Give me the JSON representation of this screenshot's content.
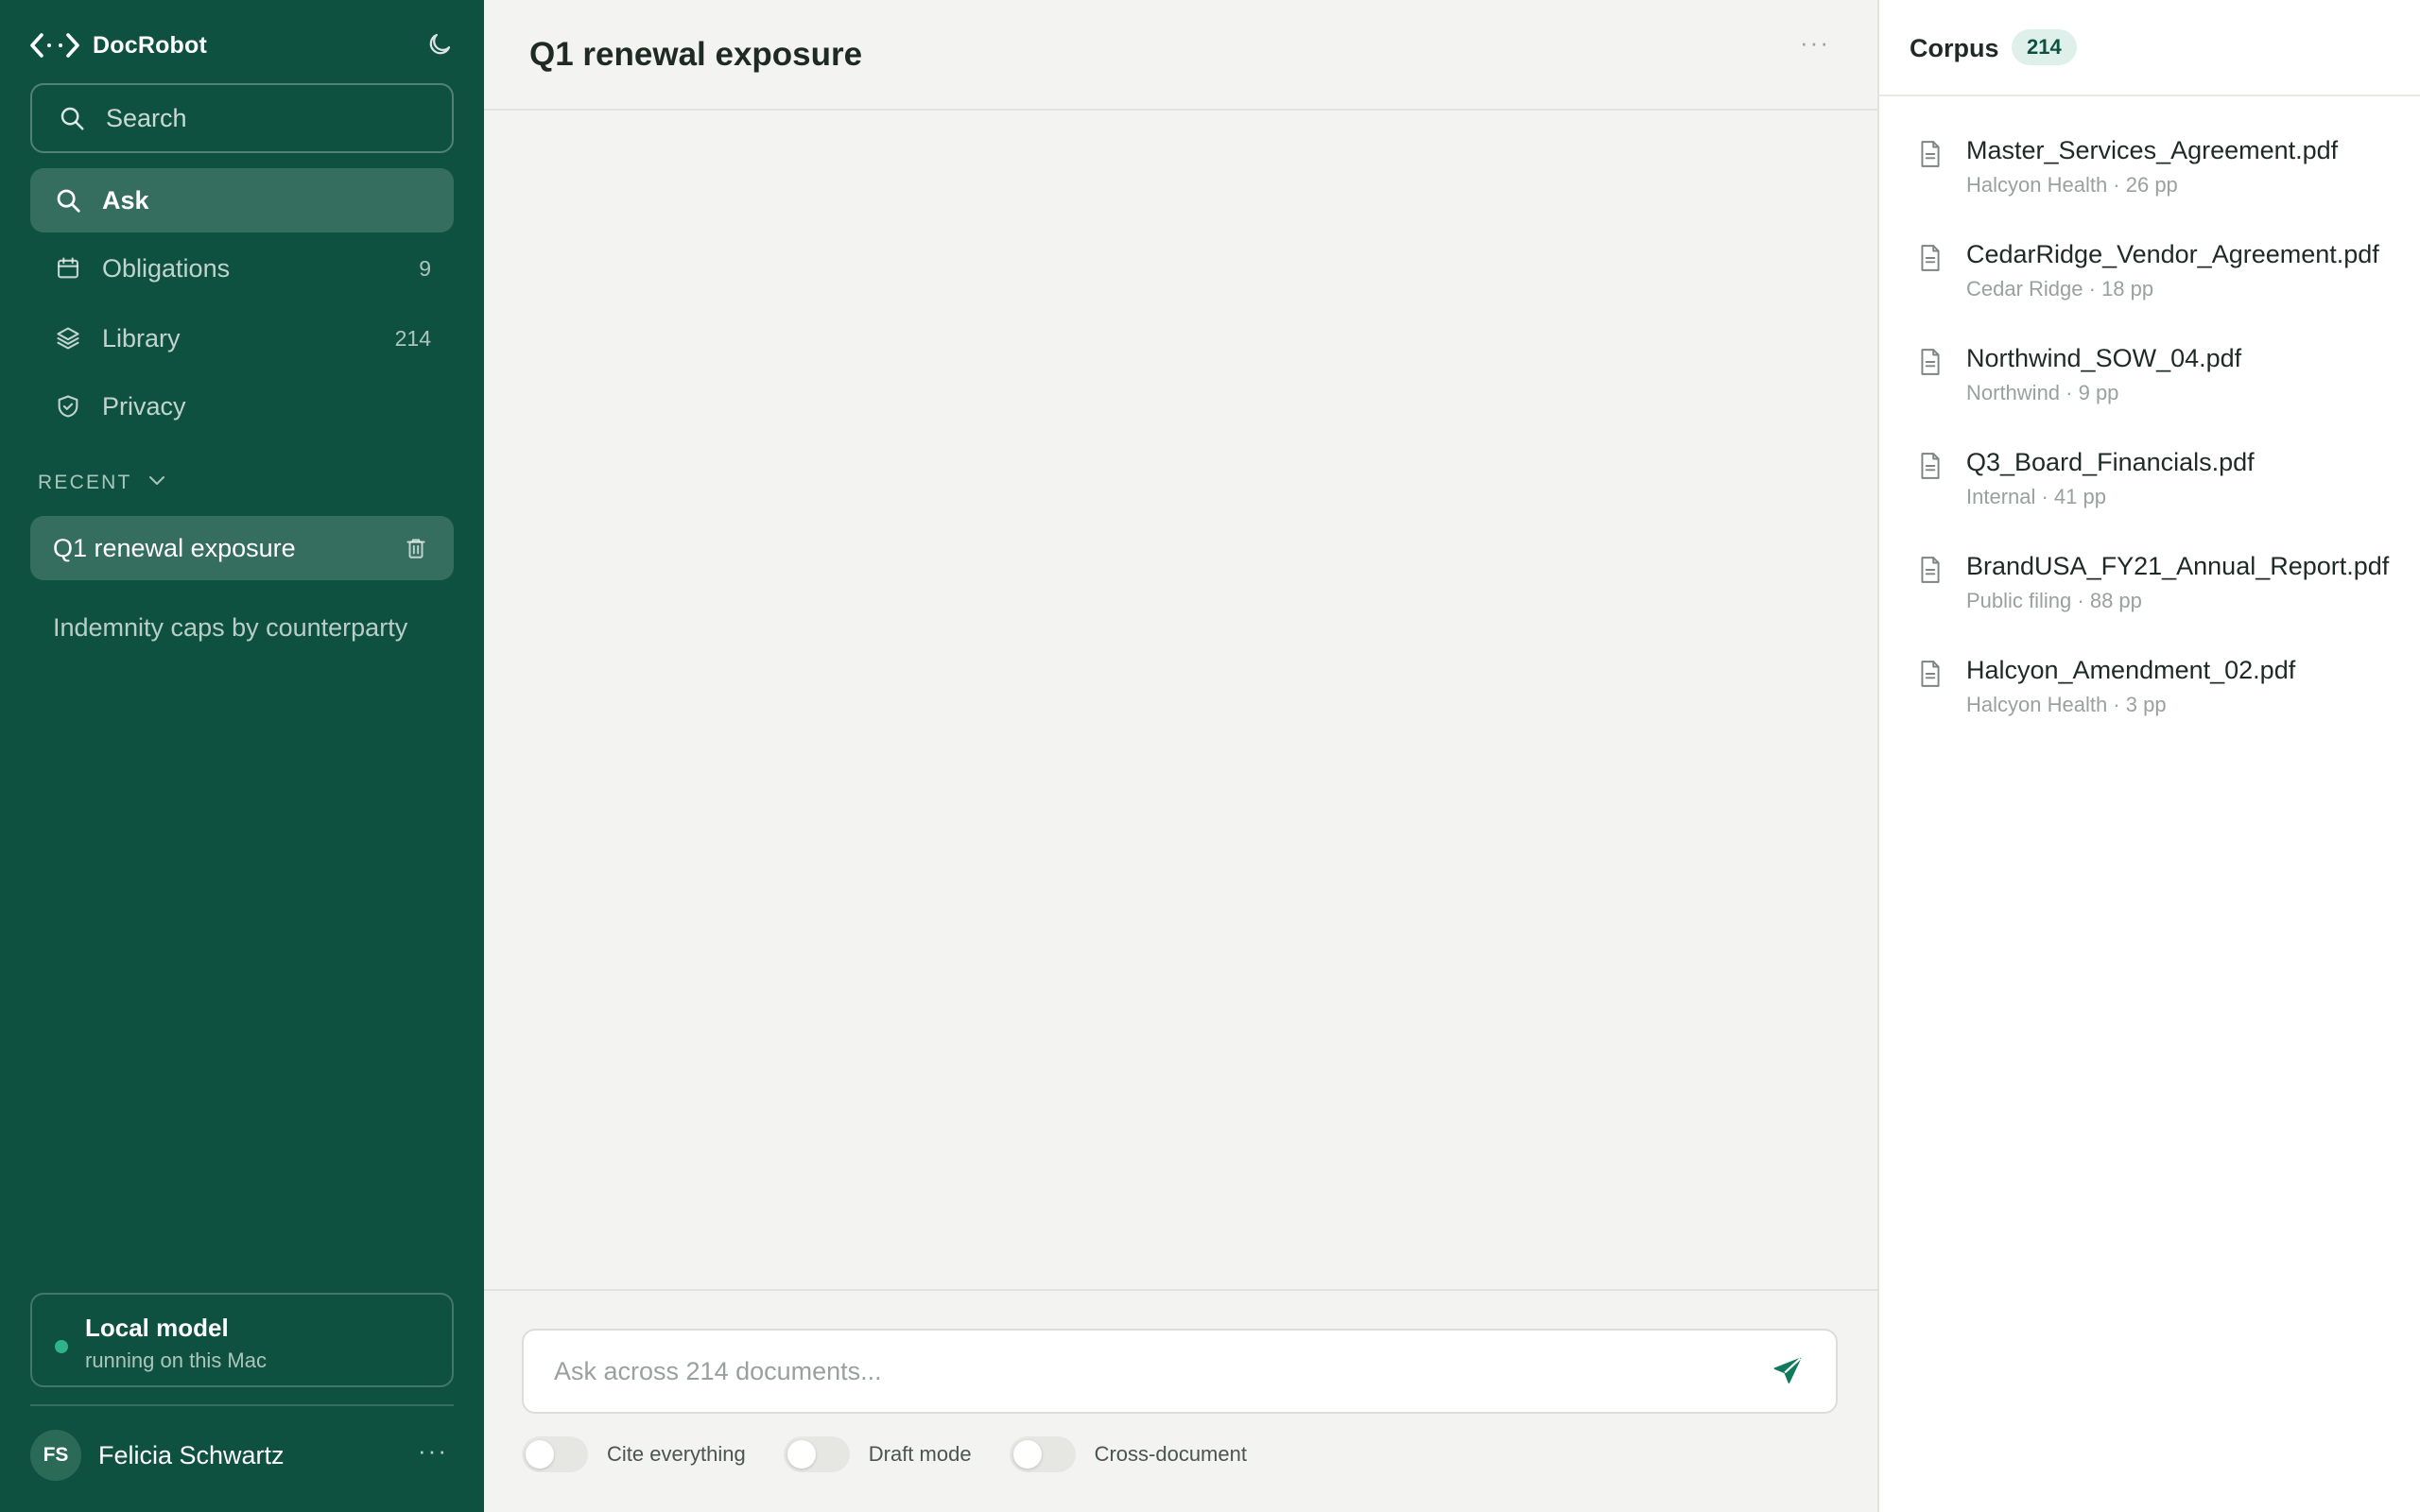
{
  "app": {
    "name": "DocRobot"
  },
  "sidebar": {
    "search_placeholder": "Search",
    "nav": [
      {
        "label": "Ask",
        "count": "",
        "active": true,
        "icon": "search-icon"
      },
      {
        "label": "Obligations",
        "count": "9",
        "active": false,
        "icon": "calendar-icon"
      },
      {
        "label": "Library",
        "count": "214",
        "active": false,
        "icon": "layers-icon"
      },
      {
        "label": "Privacy",
        "count": "",
        "active": false,
        "icon": "shield-check-icon"
      }
    ],
    "recent": {
      "label": "RECENT",
      "items": [
        {
          "label": "Q1 renewal exposure",
          "active": true
        },
        {
          "label": "Indemnity caps by counterparty",
          "active": false
        }
      ]
    },
    "model": {
      "title": "Local model",
      "subtitle": "running on this Mac",
      "status_color": "#2fb38a"
    },
    "user": {
      "initials": "FS",
      "name": "Felicia Schwartz"
    }
  },
  "main": {
    "title": "Q1 renewal exposure",
    "composer": {
      "placeholder": "Ask across 214 documents...",
      "value": ""
    },
    "toggles": [
      {
        "label": "Cite everything",
        "on": false
      },
      {
        "label": "Draft mode",
        "on": false
      },
      {
        "label": "Cross-document",
        "on": false
      }
    ]
  },
  "corpus": {
    "title": "Corpus",
    "count": "214",
    "documents": [
      {
        "name": "Master_Services_Agreement.pdf",
        "meta": "Halcyon Health · 26 pp"
      },
      {
        "name": "CedarRidge_Vendor_Agreement.pdf",
        "meta": "Cedar Ridge · 18 pp"
      },
      {
        "name": "Northwind_SOW_04.pdf",
        "meta": "Northwind · 9 pp"
      },
      {
        "name": "Q3_Board_Financials.pdf",
        "meta": "Internal · 41 pp"
      },
      {
        "name": "BrandUSA_FY21_Annual_Report.pdf",
        "meta": "Public filing · 88 pp"
      },
      {
        "name": "Halcyon_Amendment_02.pdf",
        "meta": "Halcyon Health · 3 pp"
      }
    ]
  },
  "colors": {
    "sidebar_bg": "#0f5140",
    "accent": "#0f7a5c",
    "main_bg": "#f3f3f1",
    "panel_bg": "#ffffff"
  }
}
